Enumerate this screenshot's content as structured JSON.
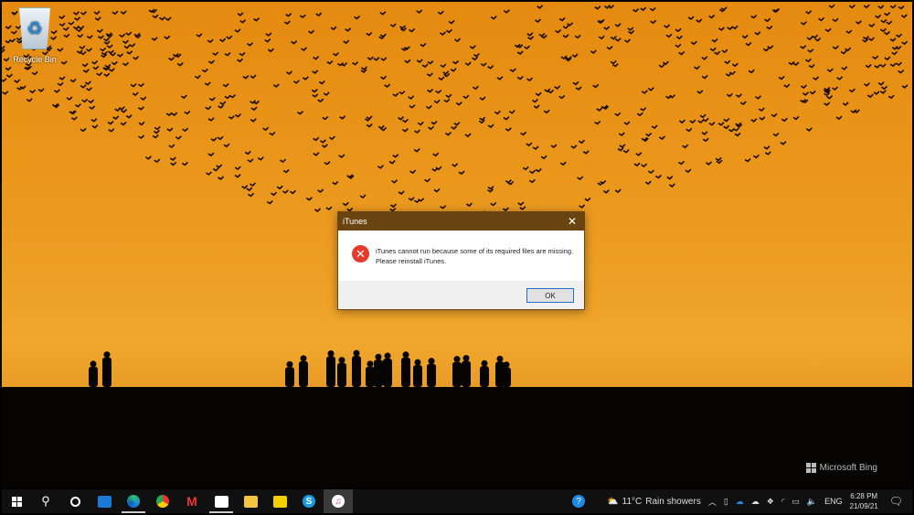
{
  "desktop": {
    "recycle_bin_label": "Recycle Bin",
    "watermark": "Microsoft Bing"
  },
  "dialog": {
    "title": "iTunes",
    "message_line1": "iTunes cannot run because some of its required files are missing.",
    "message_line2": "Please reinstall iTunes.",
    "ok_label": "OK",
    "close_glyph": "✕"
  },
  "taskbar": {
    "apps": [
      "start",
      "search",
      "cortana",
      "mail",
      "edge",
      "chrome",
      "gmail",
      "store",
      "file-explorer",
      "sticky-notes",
      "skype",
      "itunes"
    ],
    "weather": {
      "temp": "11°C",
      "condition": "Rain showers"
    },
    "language": "ENG",
    "time": "6:28 PM",
    "date": "21/09/21"
  },
  "colors": {
    "title_bar": "#6a4410",
    "error": "#e53a2b",
    "taskbar": "#101010"
  }
}
